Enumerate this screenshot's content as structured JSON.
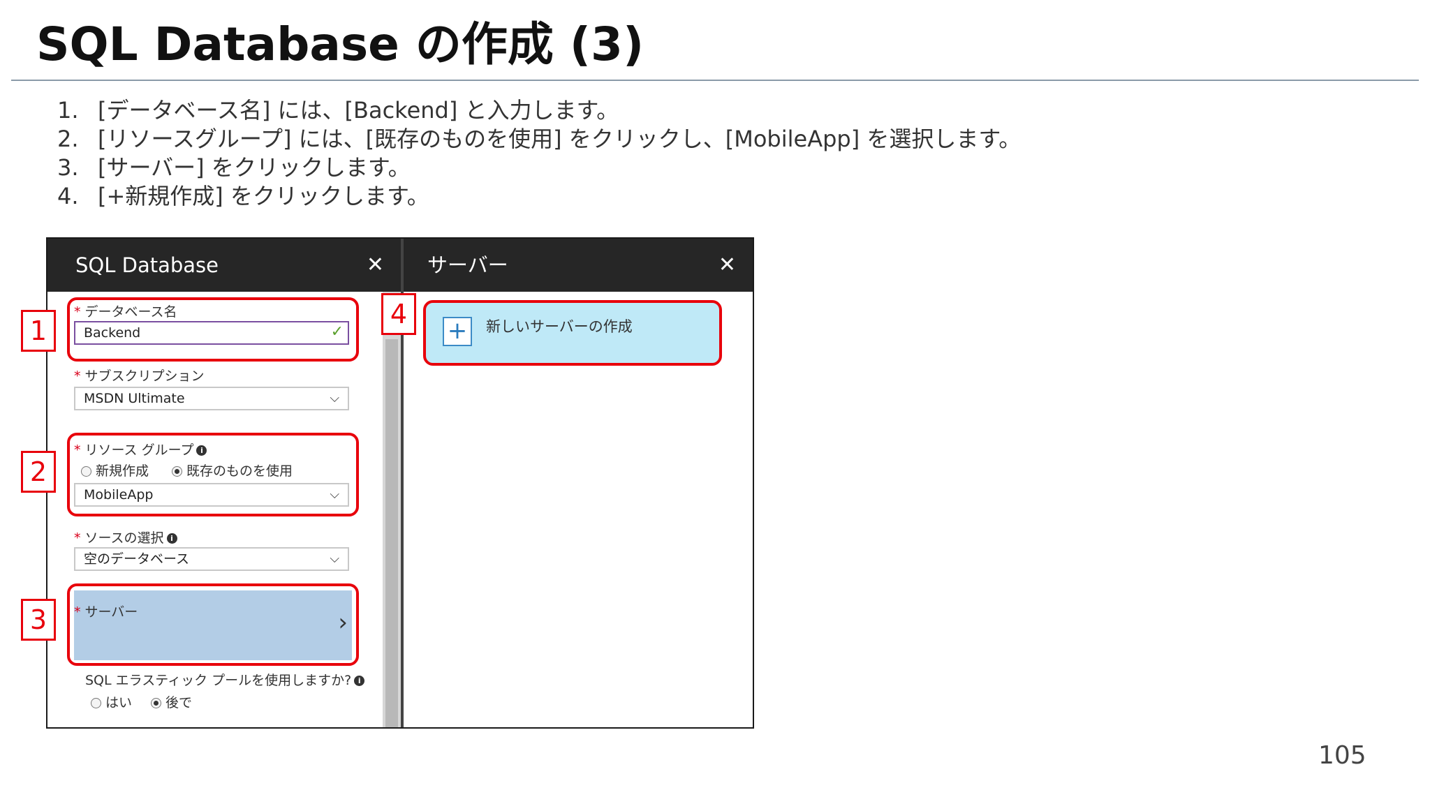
{
  "slide": {
    "title": "SQL Database の作成 (3)",
    "page_number": "105"
  },
  "steps": [
    {
      "num": "1.",
      "text": "[データベース名] には、[Backend] と入力します。"
    },
    {
      "num": "2.",
      "text": "[リソースグループ] には、[既存のものを使用] をクリックし、[MobileApp] を選択します。"
    },
    {
      "num": "3.",
      "text": "[サーバー] をクリックします。"
    },
    {
      "num": "4.",
      "text": "[+新規作成] をクリックします。"
    }
  ],
  "sql_blade": {
    "title": "SQL Database",
    "close": "✕",
    "db_name_label": "データベース名",
    "db_name_value": "Backend",
    "subscription_label": "サブスクリプション",
    "subscription_value": "MSDN Ultimate",
    "resource_group_label": "リソース グループ",
    "rg_new_option": "新規作成",
    "rg_existing_option": "既存のものを使用",
    "rg_selected": "existing",
    "resource_group_value": "MobileApp",
    "source_label": "ソースの選択",
    "source_value": "空のデータベース",
    "server_label": "サーバー",
    "elastic_label": "SQL エラスティック プールを使用しますか?",
    "elastic_yes": "はい",
    "elastic_later": "後で",
    "elastic_selected": "later",
    "required_mark": "*",
    "info_mark": "i"
  },
  "server_blade": {
    "title": "サーバー",
    "close": "✕",
    "new_server_label": "新しいサーバーの作成"
  },
  "markers": [
    "1",
    "2",
    "3",
    "4"
  ],
  "colors": {
    "highlight": "#e8000b",
    "header": "#262626",
    "server_row": "#b3cde6",
    "new_server": "#bfe9f7"
  }
}
